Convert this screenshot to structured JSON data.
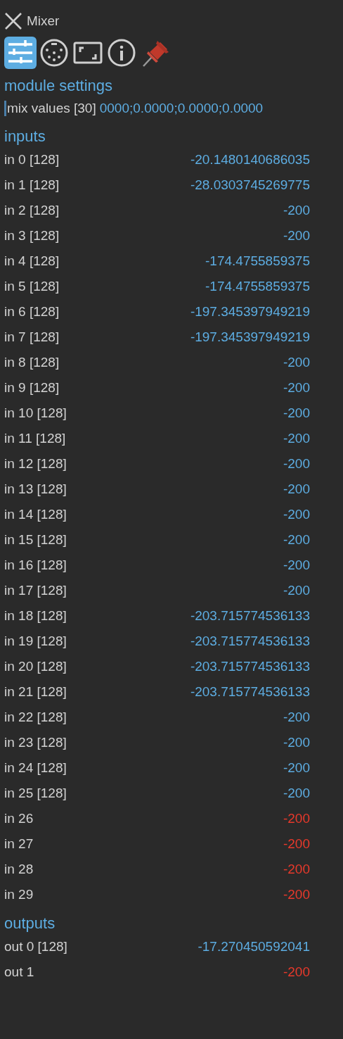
{
  "window": {
    "title": "Mixer"
  },
  "toolbar": [
    {
      "kind": "sliders",
      "selected": true
    },
    {
      "kind": "connector",
      "selected": false
    },
    {
      "kind": "frame",
      "selected": false
    },
    {
      "kind": "info",
      "selected": false
    },
    {
      "kind": "pin",
      "selected": false
    }
  ],
  "sections": [
    {
      "title": "module settings",
      "rows": [
        {
          "label": "mix values [30]",
          "value": "0000;0.0000;0.0000;0.0000",
          "connected": true,
          "kind": "field",
          "caret": true
        }
      ]
    },
    {
      "title": "inputs",
      "rows": [
        {
          "label": "in 0 [128]",
          "value": "-20.1480140686035",
          "connected": true
        },
        {
          "label": "in 1 [128]",
          "value": "-28.0303745269775",
          "connected": true
        },
        {
          "label": "in 2 [128]",
          "value": "-200",
          "connected": true
        },
        {
          "label": "in 3 [128]",
          "value": "-200",
          "connected": true
        },
        {
          "label": "in 4 [128]",
          "value": "-174.4755859375",
          "connected": true
        },
        {
          "label": "in 5 [128]",
          "value": "-174.4755859375",
          "connected": true
        },
        {
          "label": "in 6 [128]",
          "value": "-197.345397949219",
          "connected": true
        },
        {
          "label": "in 7 [128]",
          "value": "-197.345397949219",
          "connected": true
        },
        {
          "label": "in 8 [128]",
          "value": "-200",
          "connected": true
        },
        {
          "label": "in 9 [128]",
          "value": "-200",
          "connected": true
        },
        {
          "label": "in 10 [128]",
          "value": "-200",
          "connected": true
        },
        {
          "label": "in 11 [128]",
          "value": "-200",
          "connected": true
        },
        {
          "label": "in 12 [128]",
          "value": "-200",
          "connected": true
        },
        {
          "label": "in 13 [128]",
          "value": "-200",
          "connected": true
        },
        {
          "label": "in 14 [128]",
          "value": "-200",
          "connected": true
        },
        {
          "label": "in 15 [128]",
          "value": "-200",
          "connected": true
        },
        {
          "label": "in 16 [128]",
          "value": "-200",
          "connected": true
        },
        {
          "label": "in 17 [128]",
          "value": "-200",
          "connected": true
        },
        {
          "label": "in 18 [128]",
          "value": "-203.715774536133",
          "connected": true
        },
        {
          "label": "in 19 [128]",
          "value": "-203.715774536133",
          "connected": true
        },
        {
          "label": "in 20 [128]",
          "value": "-203.715774536133",
          "connected": true
        },
        {
          "label": "in 21 [128]",
          "value": "-203.715774536133",
          "connected": true
        },
        {
          "label": "in 22 [128]",
          "value": "-200",
          "connected": true
        },
        {
          "label": "in 23 [128]",
          "value": "-200",
          "connected": true
        },
        {
          "label": "in 24 [128]",
          "value": "-200",
          "connected": true
        },
        {
          "label": "in 25 [128]",
          "value": "-200",
          "connected": true
        },
        {
          "label": "in 26",
          "value": "-200",
          "connected": false
        },
        {
          "label": "in 27",
          "value": "-200",
          "connected": false
        },
        {
          "label": "in 28",
          "value": "-200",
          "connected": false
        },
        {
          "label": "in 29",
          "value": "-200",
          "connected": false
        }
      ]
    },
    {
      "title": "outputs",
      "rows": [
        {
          "label": "out 0 [128]",
          "value": "-17.270450592041",
          "connected": true
        },
        {
          "label": "out 1",
          "value": "-200",
          "connected": false
        }
      ]
    }
  ]
}
